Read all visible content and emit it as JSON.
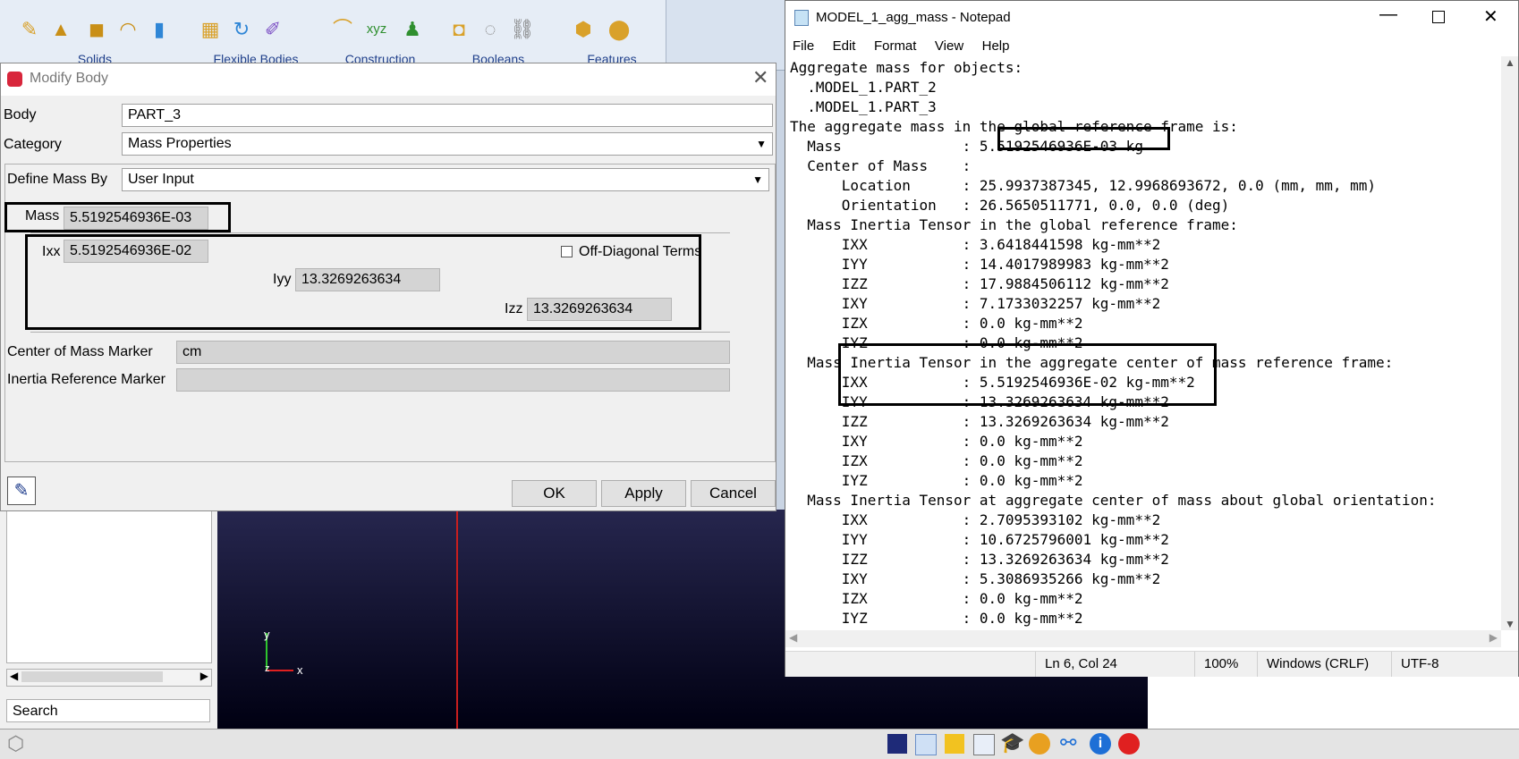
{
  "ribbon": {
    "groups": [
      "Solids",
      "Flexible Bodies",
      "Construction",
      "Booleans",
      "Features"
    ]
  },
  "dialog": {
    "title": "Modify Body",
    "body_label": "Body",
    "body_value": "PART_3",
    "category_label": "Category",
    "category_value": "Mass Properties",
    "define_mass_label": "Define Mass By",
    "define_mass_value": "User Input",
    "mass_label": "Mass",
    "mass_value": "5.5192546936E-03",
    "ixx_label": "Ixx",
    "ixx_value": "5.5192546936E-02",
    "iyy_label": "Iyy",
    "iyy_value": "13.3269263634",
    "izz_label": "Izz",
    "izz_value": "13.3269263634",
    "off_diagonal_label": "Off-Diagonal Terms",
    "com_marker_label": "Center of Mass Marker",
    "com_marker_value": "cm",
    "inertia_marker_label": "Inertia Reference Marker",
    "inertia_marker_value": "",
    "ok_label": "OK",
    "apply_label": "Apply",
    "cancel_label": "Cancel"
  },
  "left_panel": {
    "search_label": "Search"
  },
  "viewport": {
    "axis_y": "y",
    "axis_x": "x",
    "axis_z": "z"
  },
  "notepad": {
    "title": "MODEL_1_agg_mass - Notepad",
    "menu": [
      "File",
      "Edit",
      "Format",
      "View",
      "Help"
    ],
    "lines": [
      "Aggregate mass for objects:",
      "  .MODEL_1.PART_2",
      "  .MODEL_1.PART_3",
      "The aggregate mass in the global reference frame is:",
      "  Mass              : 5.5192546936E-03 kg",
      "  Center of Mass    :",
      "      Location      : 25.9937387345, 12.9968693672, 0.0 (mm, mm, mm)",
      "      Orientation   : 26.5650511771, 0.0, 0.0 (deg)",
      "  Mass Inertia Tensor in the global reference frame:",
      "      IXX           : 3.6418441598 kg-mm**2",
      "      IYY           : 14.4017989983 kg-mm**2",
      "      IZZ           : 17.9884506112 kg-mm**2",
      "      IXY           : 7.1733032257 kg-mm**2",
      "      IZX           : 0.0 kg-mm**2",
      "      IYZ           : 0.0 kg-mm**2",
      "  Mass Inertia Tensor in the aggregate center of mass reference frame:",
      "      IXX           : 5.5192546936E-02 kg-mm**2",
      "      IYY           : 13.3269263634 kg-mm**2",
      "      IZZ           : 13.3269263634 kg-mm**2",
      "      IXY           : 0.0 kg-mm**2",
      "      IZX           : 0.0 kg-mm**2",
      "      IYZ           : 0.0 kg-mm**2",
      "  Mass Inertia Tensor at aggregate center of mass about global orientation:",
      "      IXX           : 2.7095393102 kg-mm**2",
      "      IYY           : 10.6725796001 kg-mm**2",
      "      IZZ           : 13.3269263634 kg-mm**2",
      "      IXY           : 5.3086935266 kg-mm**2",
      "      IZX           : 0.0 kg-mm**2",
      "      IYZ           : 0.0 kg-mm**2"
    ],
    "status": {
      "position": "Ln 6, Col 24",
      "zoom": "100%",
      "line_ending": "Windows (CRLF)",
      "encoding": "UTF-8"
    }
  }
}
